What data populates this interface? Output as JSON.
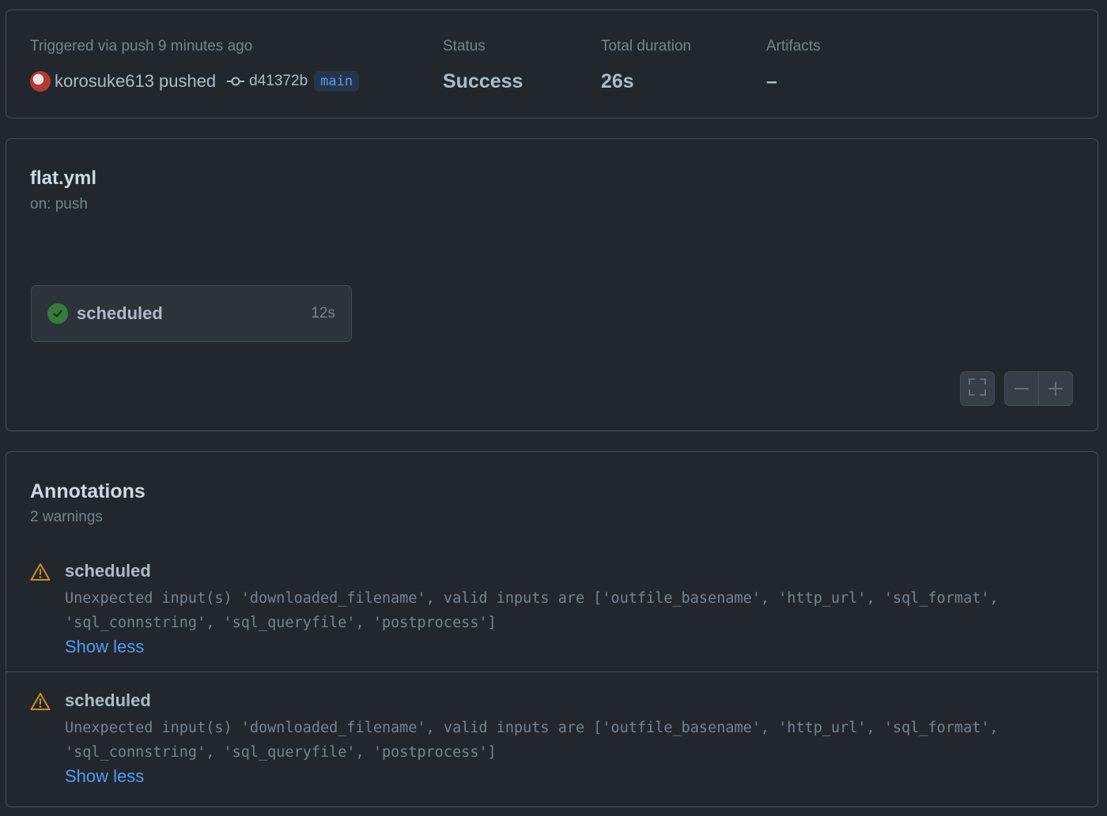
{
  "summary": {
    "trigger_label": "Triggered via push 9 minutes ago",
    "actor": "korosuke613",
    "action": "pushed",
    "commit_sha": "d41372b",
    "branch": "main",
    "status_label": "Status",
    "status_value": "Success",
    "duration_label": "Total duration",
    "duration_value": "26s",
    "artifacts_label": "Artifacts",
    "artifacts_value": "–"
  },
  "workflow": {
    "file": "flat.yml",
    "trigger": "on: push",
    "jobs": [
      {
        "name": "scheduled",
        "duration": "12s",
        "status": "success"
      }
    ]
  },
  "annotations": {
    "title": "Annotations",
    "count_label": "2 warnings",
    "items": [
      {
        "job": "scheduled",
        "message": "Unexpected input(s) 'downloaded_filename', valid inputs are ['outfile_basename', 'http_url', 'sql_format',\n'sql_connstring', 'sql_queryfile', 'postprocess']",
        "toggle_label": "Show less",
        "icon": "alert-icon"
      },
      {
        "job": "scheduled",
        "message": "Unexpected input(s) 'downloaded_filename', valid inputs are ['outfile_basename', 'http_url', 'sql_format',\n'sql_connstring', 'sql_queryfile', 'postprocess']",
        "toggle_label": "Show less",
        "icon": "alert-icon"
      }
    ]
  },
  "colors": {
    "background": "#22272e",
    "border": "#444c56",
    "link": "#539bf5",
    "success": "#347d39",
    "warning": "#c69026"
  }
}
